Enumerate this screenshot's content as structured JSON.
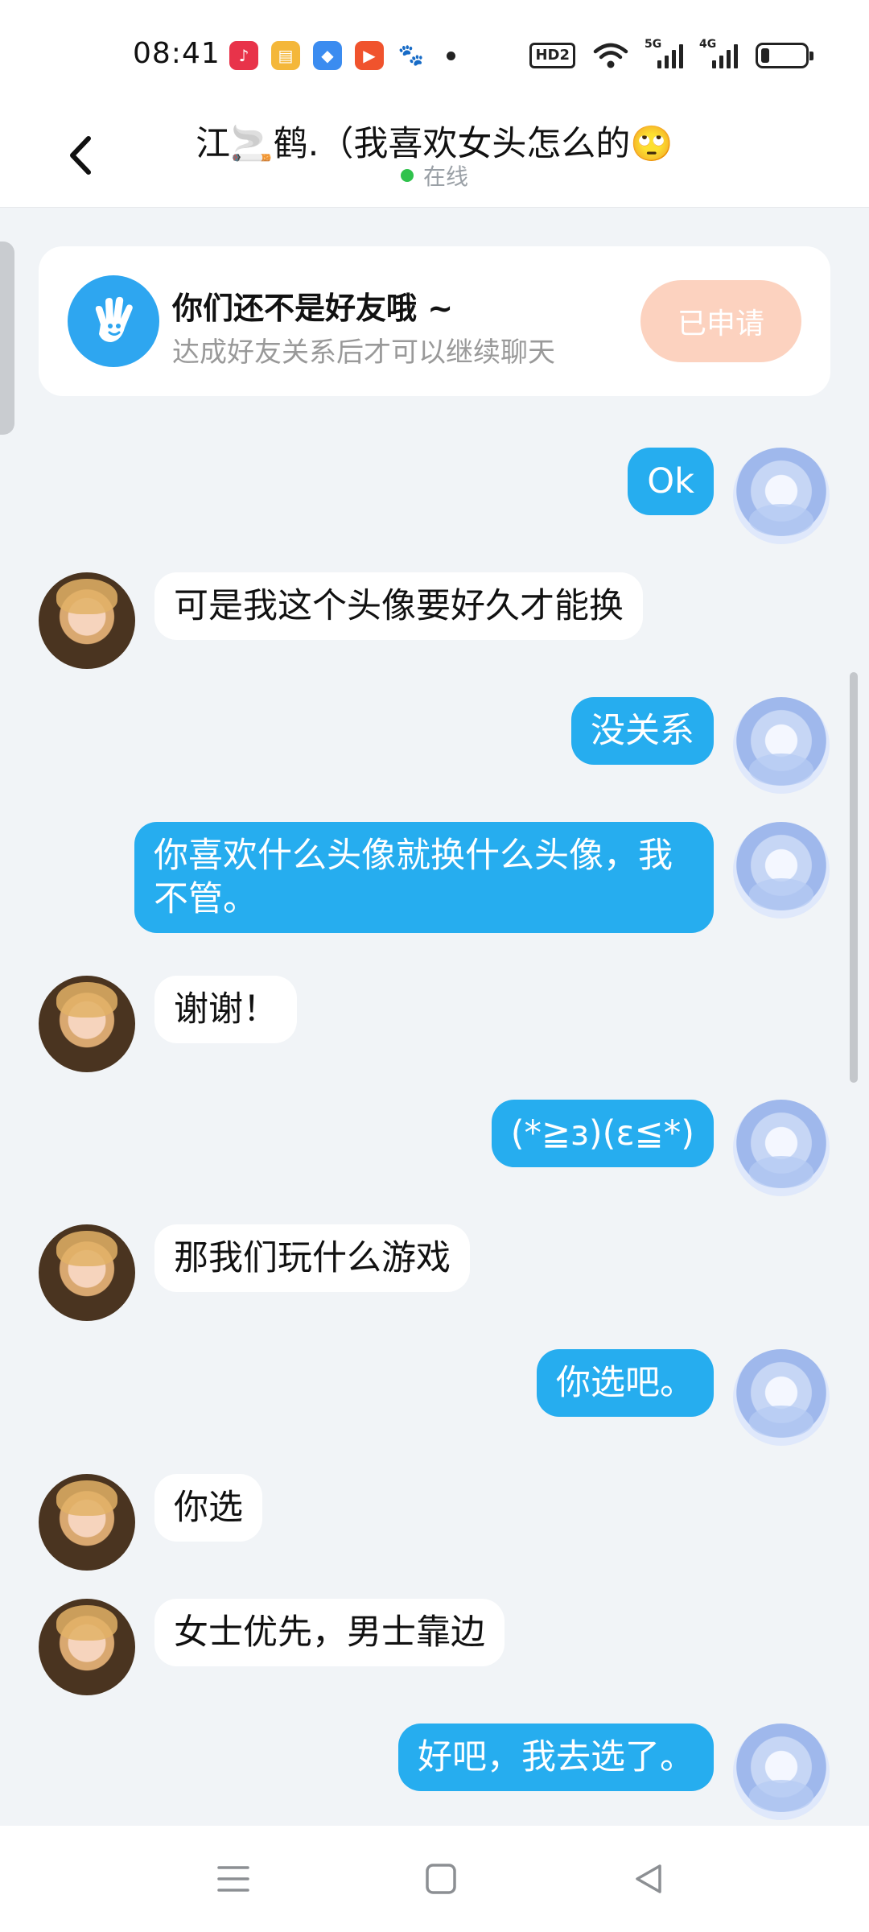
{
  "status_bar": {
    "time": "08:41",
    "hd_label": "HD2",
    "signal_5g": "5G",
    "signal_4g": "4G",
    "battery_level": 0.2
  },
  "title_bar": {
    "name": "江🚬鹤.（我喜欢女头怎么的🙄",
    "status": "在线"
  },
  "friend_card": {
    "title": "你们还不是好友哦 ~",
    "subtitle": "达成好友关系后才可以继续聊天",
    "button": "已申请"
  },
  "messages": [
    {
      "from": "me",
      "text": "Ok"
    },
    {
      "from": "her",
      "text": "可是我这个头像要好久才能换"
    },
    {
      "from": "me",
      "text": "没关系"
    },
    {
      "from": "me",
      "text": "你喜欢什么头像就换什么头像，我不管。"
    },
    {
      "from": "her",
      "text": "谢谢！"
    },
    {
      "from": "me",
      "text": "(*≧з)(ε≦*)"
    },
    {
      "from": "her",
      "text": "那我们玩什么游戏"
    },
    {
      "from": "me",
      "text": "你选吧。"
    },
    {
      "from": "her",
      "text": "你选"
    },
    {
      "from": "her",
      "text": "女士优先，男士靠边"
    },
    {
      "from": "me",
      "text": "好吧，我去选了。"
    }
  ],
  "colors": {
    "outgoing_bubble": "#26adef",
    "incoming_bubble": "#ffffff",
    "chat_background": "#f1f4f7",
    "online": "#2fc24c",
    "applied_button": "#fcd2bf"
  }
}
